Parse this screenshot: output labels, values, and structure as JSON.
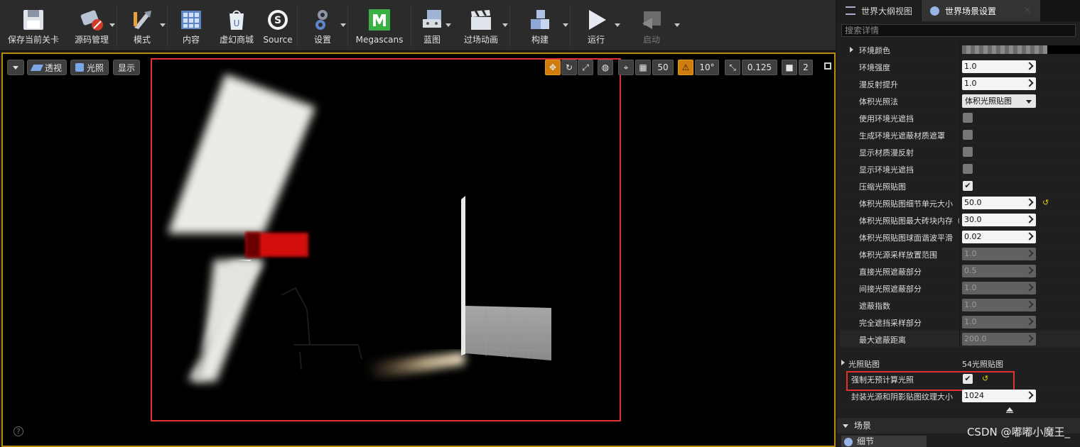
{
  "toolbar": {
    "items": [
      {
        "label": "保存当前关卡",
        "icon": "save-icon"
      },
      {
        "label": "源码管理",
        "icon": "source-control-icon"
      },
      {
        "label": "模式",
        "icon": "modes-icon"
      },
      {
        "label": "内容",
        "icon": "content-icon"
      },
      {
        "label": "虚幻商城",
        "icon": "marketplace-icon"
      },
      {
        "label": "Source",
        "icon": "source-icon"
      },
      {
        "label": "设置",
        "icon": "settings-icon"
      },
      {
        "label": "Megascans",
        "icon": "megascans-icon"
      },
      {
        "label": "蓝图",
        "icon": "blueprint-icon"
      },
      {
        "label": "过场动画",
        "icon": "cinematics-icon"
      },
      {
        "label": "构建",
        "icon": "build-icon"
      },
      {
        "label": "运行",
        "icon": "play-icon"
      },
      {
        "label": "启动",
        "icon": "launch-icon"
      }
    ]
  },
  "viewport": {
    "perspective_label": "透视",
    "lit_label": "光照",
    "show_label": "显示",
    "grid_snap": "50",
    "rotate_snap": "10°",
    "scale_snap": "0.125",
    "camera_speed": "2"
  },
  "panel": {
    "tabs": [
      {
        "label": "世界大纲视图",
        "icon": "outliner-icon"
      },
      {
        "label": "世界场景设置",
        "icon": "world-icon"
      }
    ],
    "search_placeholder": "搜索详情",
    "properties": [
      {
        "label": "环境颜色",
        "type": "color"
      },
      {
        "label": "环境强度",
        "type": "number",
        "value": "1.0"
      },
      {
        "label": "漫反射提升",
        "type": "number",
        "value": "1.0"
      },
      {
        "label": "体积光照法",
        "type": "combo",
        "value": "体积光照贴图"
      },
      {
        "label": "使用环境光遮挡",
        "type": "check",
        "checked": false
      },
      {
        "label": "生成环境光遮蔽材质遮罩",
        "type": "check",
        "checked": false
      },
      {
        "label": "显示材质漫反射",
        "type": "check",
        "checked": false
      },
      {
        "label": "显示环境光遮挡",
        "type": "check",
        "checked": false
      },
      {
        "label": "压缩光照贴图",
        "type": "check",
        "checked": true
      },
      {
        "label": "体积光照贴图细节单元大小",
        "type": "number",
        "value": "50.0",
        "reset": true
      },
      {
        "label": "体积光照贴图最大砖块内存（",
        "type": "number",
        "value": "30.0"
      },
      {
        "label": "体积光照贴图球面谐波平滑",
        "type": "number",
        "value": "0.02"
      },
      {
        "label": "体积光源采样放置范围",
        "type": "number",
        "value": "1.0",
        "disabled": true
      },
      {
        "label": "直接光照遮蔽部分",
        "type": "number",
        "value": "0.5",
        "disabled": true
      },
      {
        "label": "间接光照遮蔽部分",
        "type": "number",
        "value": "1.0",
        "disabled": true
      },
      {
        "label": "遮蔽指数",
        "type": "number",
        "value": "1.0",
        "disabled": true
      },
      {
        "label": "完全遮挡采样部分",
        "type": "number",
        "value": "1.0",
        "disabled": true
      },
      {
        "label": "最大遮蔽距离",
        "type": "number",
        "value": "200.0",
        "disabled": true
      }
    ],
    "lightmaps": {
      "label": "光照贴图",
      "value": "54光照贴图"
    },
    "force_no_precomputed": {
      "label": "强制无预计算光照",
      "checked": true
    },
    "packed_size": {
      "label": "封装光源和阴影贴图纹理大小",
      "value": "1024"
    },
    "scene_category": "场景",
    "details_tab": "细节"
  },
  "watermark": "CSDN @嘟嘟小魔王_"
}
